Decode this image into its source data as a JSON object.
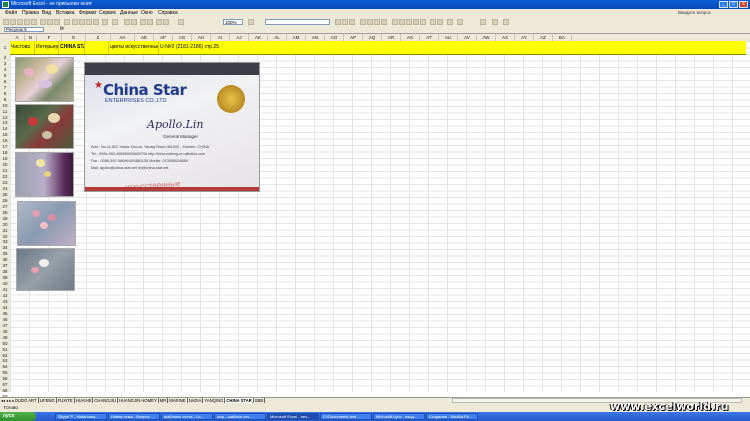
{
  "window": {
    "title": "Microsoft Excel - не присылан юнит",
    "min": "_",
    "max": "□",
    "close": "x"
  },
  "menu": [
    "Файл",
    "Правка",
    "Вид",
    "Вставка",
    "Формат",
    "Сервис",
    "Данные",
    "Окно",
    "Справка"
  ],
  "help_box": "Введите вопрос",
  "toolbar": {
    "zoom": "100%"
  },
  "formula": {
    "name_box": "Рисунок 5",
    "fx": "fx"
  },
  "columns": [
    "A",
    "B",
    "F",
    "G",
    "Z",
    "AA",
    "AE",
    "AF",
    "AG",
    "AH",
    "AI",
    "AJ",
    "AK",
    "AL",
    "AM",
    "AN",
    "AO",
    "AP",
    "AQ",
    "AR",
    "AS",
    "AT",
    "AU",
    "AV",
    "AW",
    "AX",
    "AY",
    "AZ",
    "BA"
  ],
  "rows": [
    "1",
    "2",
    "3",
    "4",
    "5",
    "6",
    "7",
    "8",
    "9",
    "10",
    "11",
    "12",
    "13",
    "14",
    "15",
    "16",
    "17",
    "18",
    "19",
    "20",
    "21",
    "22",
    "23",
    "24",
    "25",
    "26",
    "27",
    "28",
    "29",
    "30",
    "31",
    "32",
    "33",
    "34",
    "35",
    "36",
    "37",
    "38",
    "39",
    "40",
    "41",
    "42",
    "43",
    "44",
    "45",
    "46",
    "47",
    "48",
    "49",
    "50",
    "51",
    "52",
    "53",
    "54",
    "55",
    "56",
    "57",
    "58",
    "59",
    "60"
  ],
  "row1": {
    "a": "Чистова",
    "b": "Интерьер",
    "f": "CHINA STAR",
    "z": "цветы искусственные",
    "ae": "U-N#2 (2181-2186) стр.25"
  },
  "card": {
    "brand": "China Star",
    "sub": "ENTERPRISES CO.,LTD",
    "name": "Apollo.Lin",
    "title": "General Manager",
    "lines": [
      "Add.: No.11-802 Xiada Xincun, Yanaqi Road,361000 , Xiamen, CHINA",
      "Tel.: 0086-592-5656595/5668706   http://bincurufleng.en.alibaba.com",
      "Fax.: 0086-592-5669648/5881128   Mobile: 013906028689",
      "Mail: apollo@china-star.net   lin@china-star.net"
    ],
    "stamp": "искусственные"
  },
  "sheet_tabs": [
    "DUDO ART",
    "LIFENG",
    "FUXITE",
    "HUAIHE",
    "CHANGJIU",
    "HUANGJIN HOMEY",
    "MR",
    "MARINE",
    "NADIA",
    "YANQING",
    "CHINA STAR",
    "SBB"
  ],
  "active_tab": "CHINA STAR",
  "status": "Готово",
  "taskbar": {
    "start": "пуск",
    "tasks": [
      "Skype™ - tristanoma...",
      "Новая тема - Вопрос ...",
      "шаблоны счета - Lo...",
      "сыр - шаблон отч...",
      "Microsoft Excel - нез...",
      "C:\\Documents and ...",
      "Microsoft Lync - вход...",
      "Создание - Mozilla Fir..."
    ]
  },
  "watermark": "www.excelworld.ru"
}
